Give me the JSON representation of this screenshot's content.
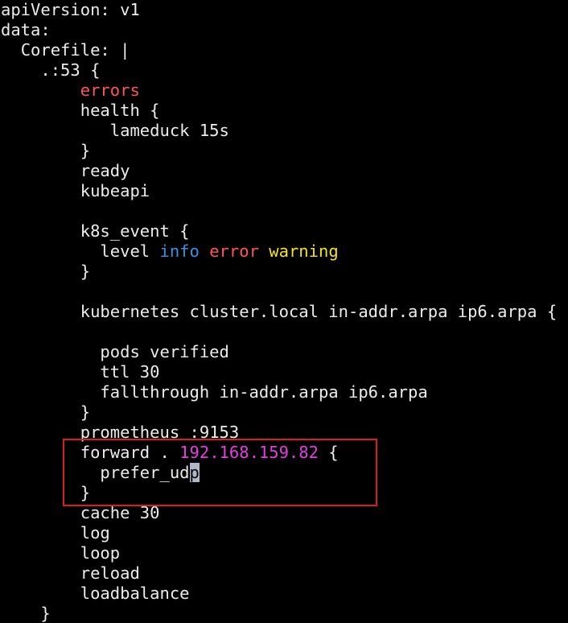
{
  "colors": {
    "background": "#000000",
    "text": "#ececec",
    "keyword_red": "#ff5555",
    "keyword_blue": "#3d8fe0",
    "keyword_yellow": "#f2e21f",
    "ip_magenta": "#e23fe0",
    "cursor_bg": "#b0b8c8",
    "highlight_box": "#d81e1e"
  },
  "editor": {
    "highlight_box_label": "",
    "lines": [
      {
        "indent": 0,
        "segments": [
          {
            "text": "apiVersion: v1"
          }
        ]
      },
      {
        "indent": 0,
        "segments": [
          {
            "text": "data:"
          }
        ]
      },
      {
        "indent": 2,
        "segments": [
          {
            "text": "Corefile: |"
          }
        ]
      },
      {
        "indent": 4,
        "segments": [
          {
            "text": ".:53 {"
          }
        ]
      },
      {
        "indent": 8,
        "segments": [
          {
            "text": "errors",
            "color": "#ff5555"
          }
        ]
      },
      {
        "indent": 8,
        "segments": [
          {
            "text": "health {"
          }
        ]
      },
      {
        "indent": 11,
        "segments": [
          {
            "text": "lameduck 15s"
          }
        ]
      },
      {
        "indent": 8,
        "segments": [
          {
            "text": "}"
          }
        ]
      },
      {
        "indent": 8,
        "segments": [
          {
            "text": "ready"
          }
        ]
      },
      {
        "indent": 8,
        "segments": [
          {
            "text": "kubeapi"
          }
        ]
      },
      {
        "indent": 0,
        "segments": []
      },
      {
        "indent": 8,
        "segments": [
          {
            "text": "k8s_event {"
          }
        ]
      },
      {
        "indent": 10,
        "segments": [
          {
            "text": "level "
          },
          {
            "text": "info",
            "color": "#3d8fe0"
          },
          {
            "text": " "
          },
          {
            "text": "error",
            "color": "#ff5555"
          },
          {
            "text": " "
          },
          {
            "text": "warning",
            "color": "#f2e21f"
          }
        ]
      },
      {
        "indent": 8,
        "segments": [
          {
            "text": "}"
          }
        ]
      },
      {
        "indent": 0,
        "segments": []
      },
      {
        "indent": 8,
        "segments": [
          {
            "text": "kubernetes cluster.local in-addr.arpa ip6.arpa {"
          }
        ]
      },
      {
        "indent": 0,
        "segments": []
      },
      {
        "indent": 10,
        "segments": [
          {
            "text": "pods verified"
          }
        ]
      },
      {
        "indent": 10,
        "segments": [
          {
            "text": "ttl 30"
          }
        ]
      },
      {
        "indent": 10,
        "segments": [
          {
            "text": "fallthrough in-addr.arpa ip6.arpa"
          }
        ]
      },
      {
        "indent": 8,
        "segments": [
          {
            "text": "}"
          }
        ]
      },
      {
        "indent": 8,
        "segments": [
          {
            "text": "prometheus :9153"
          }
        ]
      },
      {
        "indent": 8,
        "segments": [
          {
            "text": "forward . "
          },
          {
            "text": "192.168.159.82",
            "color": "#e23fe0"
          },
          {
            "text": " {"
          }
        ]
      },
      {
        "indent": 10,
        "segments": [
          {
            "text": "prefer_ud"
          },
          {
            "text": "p",
            "cursor": true
          }
        ]
      },
      {
        "indent": 8,
        "segments": [
          {
            "text": "}"
          }
        ]
      },
      {
        "indent": 8,
        "segments": [
          {
            "text": "cache 30"
          }
        ]
      },
      {
        "indent": 8,
        "segments": [
          {
            "text": "log"
          }
        ]
      },
      {
        "indent": 8,
        "segments": [
          {
            "text": "loop"
          }
        ]
      },
      {
        "indent": 8,
        "segments": [
          {
            "text": "reload"
          }
        ]
      },
      {
        "indent": 8,
        "segments": [
          {
            "text": "loadbalance"
          }
        ]
      },
      {
        "indent": 4,
        "segments": [
          {
            "text": "}"
          }
        ]
      }
    ]
  }
}
